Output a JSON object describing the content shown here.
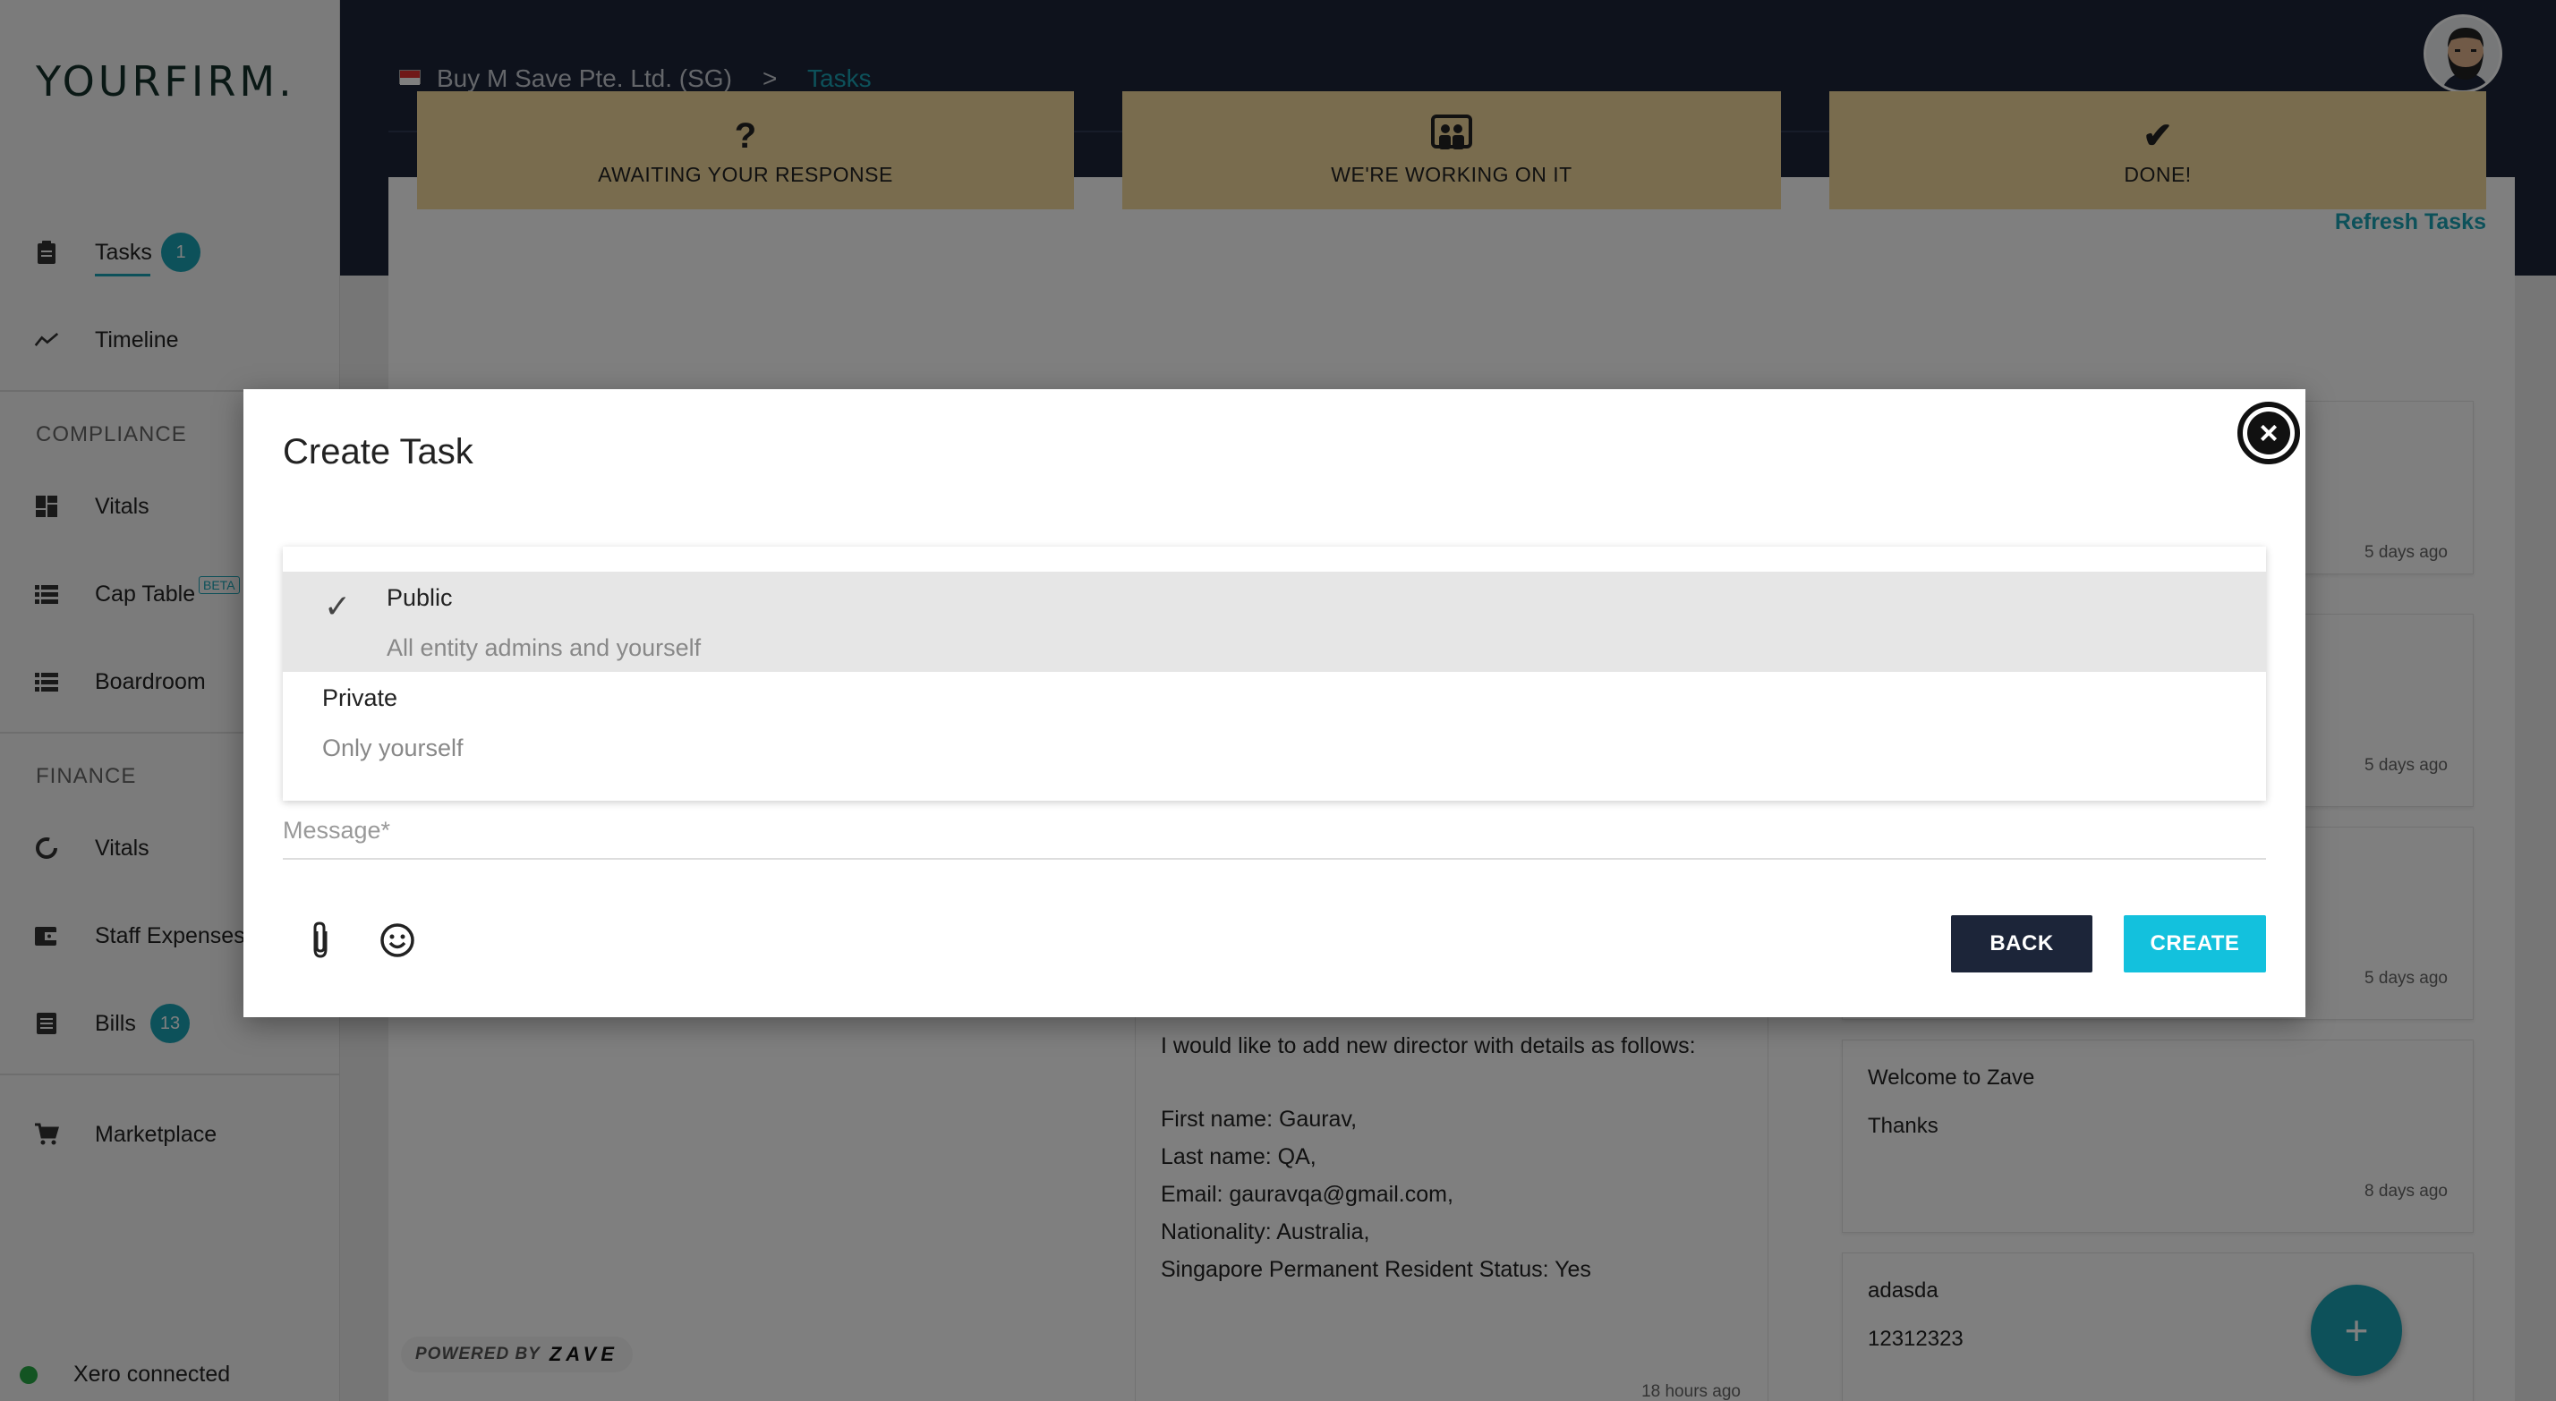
{
  "brand": {
    "logo": "YOURFIRM."
  },
  "sidebar": {
    "items": [
      {
        "label": "Tasks",
        "badge": "1"
      },
      {
        "label": "Timeline"
      }
    ],
    "compliance": {
      "heading": "COMPLIANCE",
      "items": [
        {
          "label": "Vitals"
        },
        {
          "label": "Cap Table",
          "tag": "BETA"
        },
        {
          "label": "Boardroom"
        }
      ]
    },
    "finance": {
      "heading": "FINANCE",
      "items": [
        {
          "label": "Vitals"
        },
        {
          "label": "Staff Expenses"
        },
        {
          "label": "Bills",
          "badge": "13"
        }
      ]
    },
    "marketplace": {
      "label": "Marketplace"
    },
    "status": "Xero connected"
  },
  "header": {
    "entity": "Buy M Save Pte. Ltd. (SG)",
    "separator": ">",
    "current": "Tasks"
  },
  "board": {
    "refresh_label": "Refresh Tasks",
    "columns": [
      {
        "icon": "question-icon",
        "glyph": "?",
        "title": "AWAITING YOUR RESPONSE"
      },
      {
        "icon": "team-icon",
        "glyph": "",
        "title": "WE'RE WORKING ON IT"
      },
      {
        "icon": "check-icon",
        "glyph": "✔",
        "title": "DONE!"
      }
    ],
    "done_cards": [
      {
        "time": "5 days ago"
      },
      {
        "time": "5 days ago"
      },
      {
        "time": "5 days ago"
      },
      {
        "title": "Welcome to Zave",
        "body": "Thanks",
        "time": "8 days ago"
      },
      {
        "title": "adasda",
        "body": "12312323"
      }
    ],
    "working_card": {
      "lines": [
        "I would like to add new director with details as follows:",
        "",
        "First name: Gaurav,",
        "Last name: QA,",
        "Email: gauravqa@gmail.com,",
        "Nationality: Australia,",
        "Singapore Permanent Resident Status: Yes"
      ],
      "time": "18 hours ago"
    },
    "powered_by": "POWERED BY",
    "powered_brand": "ZAVE"
  },
  "modal": {
    "title": "Create Task",
    "visibility_options": [
      {
        "label": "Public",
        "description": "All entity admins and yourself",
        "selected": true
      },
      {
        "label": "Private",
        "description": "Only yourself",
        "selected": false
      }
    ],
    "message_placeholder": "Message*",
    "back_label": "BACK",
    "create_label": "CREATE"
  },
  "colors": {
    "accent": "#1aa3b4",
    "header_bg": "#1c2539",
    "column_head_bg": "#f2d89c",
    "create_bg": "#13c1dd"
  }
}
